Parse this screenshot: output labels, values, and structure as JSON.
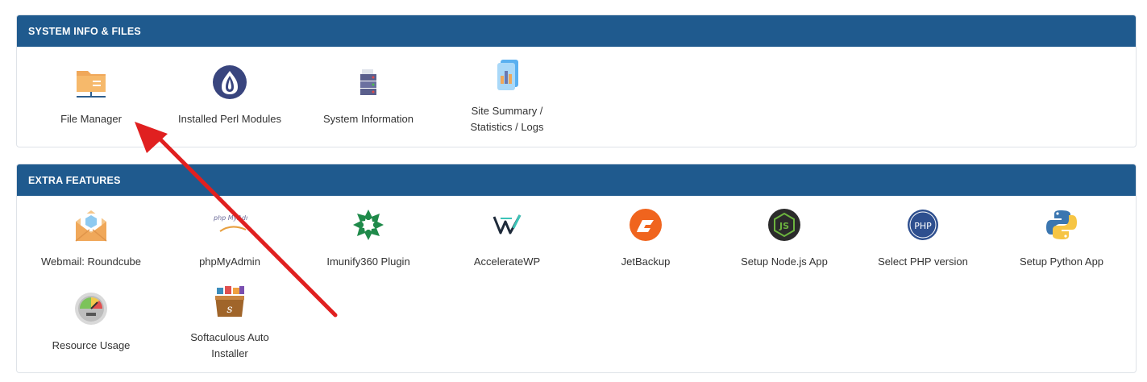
{
  "sections": {
    "system": {
      "title": "SYSTEM INFO & FILES",
      "items": [
        {
          "label": "File Manager",
          "icon": "folder-icon"
        },
        {
          "label": "Installed Perl Modules",
          "icon": "perl-icon"
        },
        {
          "label": "System Information",
          "icon": "server-icon"
        },
        {
          "label": "Site Summary / Statistics / Logs",
          "icon": "statistics-icon"
        }
      ]
    },
    "extra": {
      "title": "EXTRA FEATURES",
      "items": [
        {
          "label": "Webmail: Roundcube",
          "icon": "webmail-icon"
        },
        {
          "label": "phpMyAdmin",
          "icon": "phpmyadmin-icon",
          "logo_text": "php MyAdmin"
        },
        {
          "label": "Imunify360 Plugin",
          "icon": "imunify360-icon"
        },
        {
          "label": "AccelerateWP",
          "icon": "acceleratewp-icon"
        },
        {
          "label": "JetBackup",
          "icon": "jetbackup-icon"
        },
        {
          "label": "Setup Node.js App",
          "icon": "nodejs-icon",
          "logo_text": "JS"
        },
        {
          "label": "Select PHP version",
          "icon": "php-icon",
          "logo_text": "PHP"
        },
        {
          "label": "Setup Python App",
          "icon": "python-icon"
        },
        {
          "label": "Resource Usage",
          "icon": "gauge-icon"
        },
        {
          "label": "Softaculous Auto Installer",
          "icon": "softaculous-icon"
        }
      ]
    }
  },
  "colors": {
    "header_bg": "#1f5a8e",
    "arrow": "#e02020"
  }
}
